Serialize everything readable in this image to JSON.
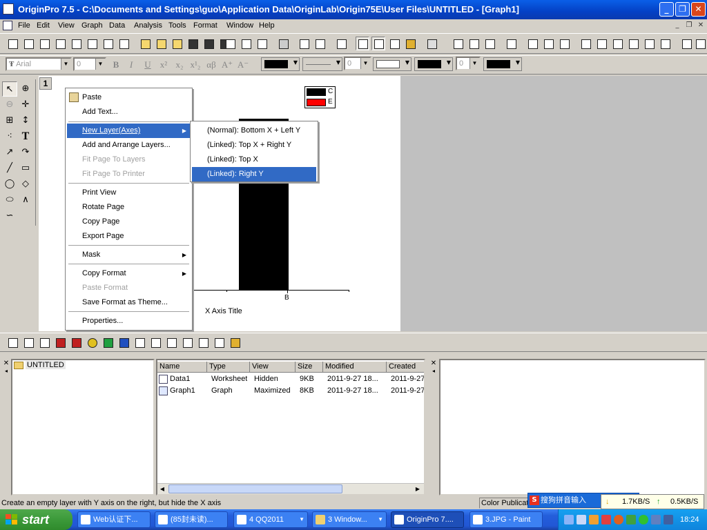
{
  "window": {
    "title": "OriginPro 7.5 - C:\\Documents and Settings\\guo\\Application Data\\OriginLab\\Origin75E\\User Files\\UNTITLED - [Graph1]"
  },
  "menubar": {
    "items": [
      "File",
      "Edit",
      "View",
      "Graph",
      "Data",
      "Analysis",
      "Tools",
      "Format",
      "Window",
      "Help"
    ]
  },
  "format_toolbar": {
    "font": "Arial",
    "font_size": "0",
    "line_width": "0",
    "symbol_size": "0"
  },
  "graph": {
    "layer_number": "1",
    "legend": [
      {
        "label": "C",
        "color": "#000000"
      },
      {
        "label": "E",
        "color": "#ff0000"
      }
    ],
    "x_tick_label": "B",
    "x_axis_title": "X Axis Title"
  },
  "context_menu": {
    "items": [
      {
        "label": "Paste",
        "disabled": false
      },
      {
        "label": "Add Text...",
        "disabled": false
      },
      {
        "label": "New Layer(Axes)",
        "disabled": false,
        "submenu": true,
        "selected": true
      },
      {
        "label": "Add and Arrange Layers...",
        "disabled": false
      },
      {
        "label": "Fit Page To Layers",
        "disabled": true
      },
      {
        "label": "Fit Page To Printer",
        "disabled": true
      },
      {
        "label": "Print View",
        "disabled": false
      },
      {
        "label": "Rotate Page",
        "disabled": false
      },
      {
        "label": "Copy Page",
        "disabled": false
      },
      {
        "label": "Export Page",
        "disabled": false
      },
      {
        "label": "Mask",
        "disabled": false,
        "submenu": true
      },
      {
        "label": "Copy Format",
        "disabled": false,
        "submenu": true
      },
      {
        "label": "Paste Format",
        "disabled": true
      },
      {
        "label": "Save Format as Theme...",
        "disabled": false
      },
      {
        "label": "Properties...",
        "disabled": false
      }
    ],
    "submenu": [
      "(Normal): Bottom X + Left Y",
      "(Linked): Top X + Right Y",
      "(Linked): Top X",
      "(Linked): Right Y"
    ]
  },
  "project_explorer": {
    "folder": "UNTITLED",
    "columns": [
      "Name",
      "Type",
      "View",
      "Size",
      "Modified",
      "Created"
    ],
    "rows": [
      [
        "Data1",
        "Worksheet",
        "Hidden",
        "9KB",
        "2011-9-27 18...",
        "2011-9-27"
      ],
      [
        "Graph1",
        "Graph",
        "Maximized",
        "8KB",
        "2011-9-27 18...",
        "2011-9-27"
      ]
    ]
  },
  "status": {
    "message": "Create an empty layer with Y axis on the right, but hide the X axis",
    "right": "Color Publicati"
  },
  "ime": {
    "label": "搜狗拼音输入",
    "down": "1.7KB/S",
    "up": "0.5KB/S"
  },
  "taskbar": {
    "start": "start",
    "tasks": [
      "Web认证下...",
      "(85封未读)...",
      "4 QQ2011",
      "3 Window...",
      "OriginPro 7....",
      "3.JPG - Paint"
    ],
    "clock": "18:24"
  }
}
